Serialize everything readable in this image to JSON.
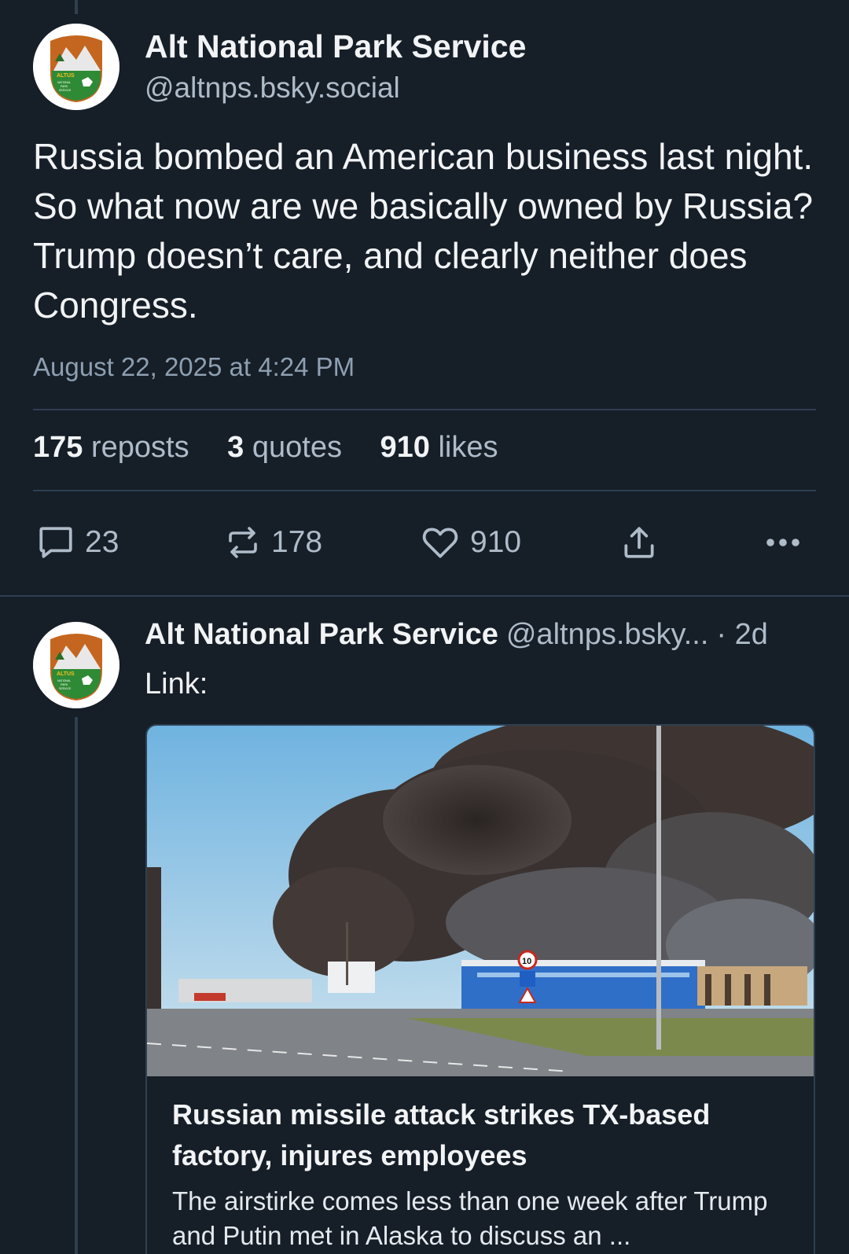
{
  "post": {
    "author_name": "Alt National Park Service",
    "author_handle": "@altnps.bsky.social",
    "text": "Russia bombed an American business last night. So what now are we basically owned by Russia? Trump doesn’t care, and clearly neither does Congress.",
    "timestamp": "August 22, 2025 at 4:24 PM",
    "stats": {
      "reposts_count": "175",
      "reposts_label": "reposts",
      "quotes_count": "3",
      "quotes_label": "quotes",
      "likes_count": "910",
      "likes_label": "likes"
    },
    "actions": {
      "reply_count": "23",
      "repost_count": "178",
      "like_count": "910"
    },
    "avatar_text": [
      "ALT",
      "US",
      "NATIONAL",
      "PARK",
      "SERVICE"
    ]
  },
  "reply": {
    "author_name": "Alt National Park Service",
    "author_handle": "@altnps.bsky...",
    "time": "· 2d",
    "text": "Link:",
    "link_card": {
      "title": "Russian missile attack strikes TX-based factory, injures employees",
      "description": "The airstirke comes less than one week after Trump and Putin met in Alaska to discuss an ...",
      "sign_text": "10"
    }
  },
  "colors": {
    "background": "#161e27",
    "divider": "#2e4052",
    "muted_text": "#aebbc9",
    "primary_text": "#f1f3f5"
  },
  "icons": [
    "reply-icon",
    "repost-icon",
    "heart-icon",
    "share-icon",
    "more-icon"
  ]
}
